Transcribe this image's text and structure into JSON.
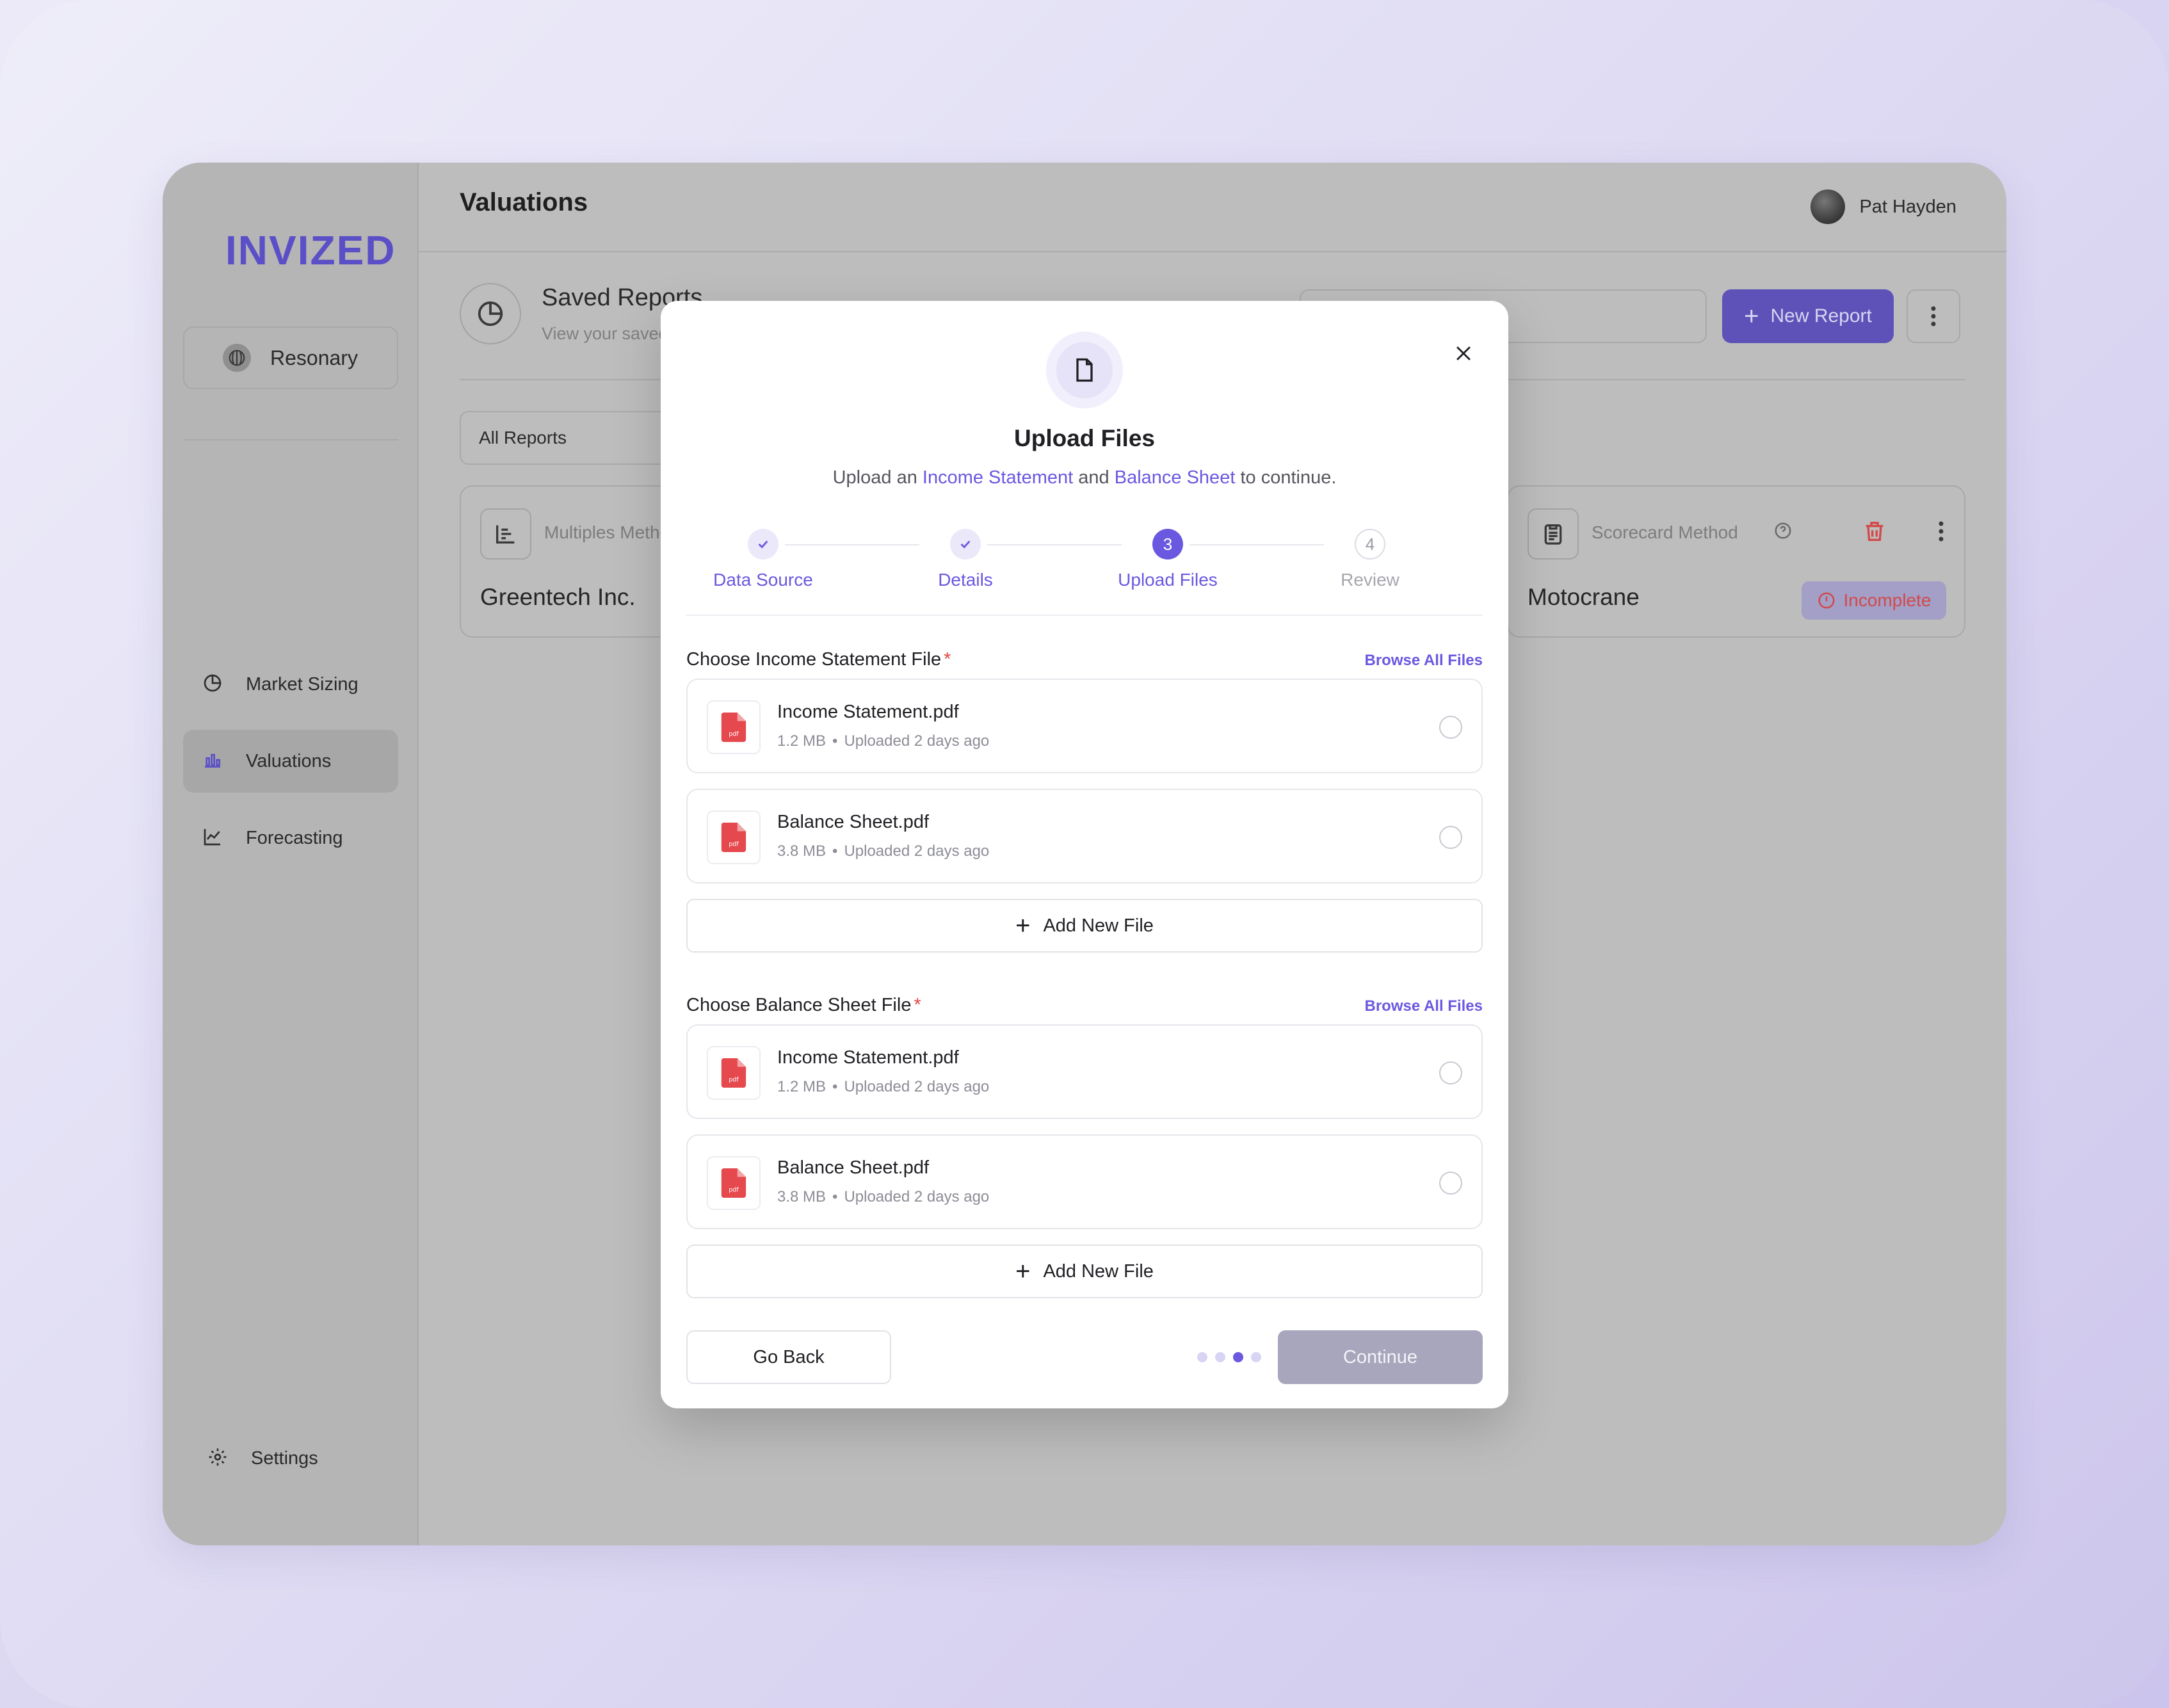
{
  "app": {
    "logo": "INVIZED",
    "workspace": "Resonary",
    "nav": [
      {
        "label": "Market Sizing",
        "icon": "pie-chart-icon"
      },
      {
        "label": "Valuations",
        "icon": "bar-chart-icon",
        "active": true
      },
      {
        "label": "Forecasting",
        "icon": "line-chart-icon"
      }
    ],
    "settings_label": "Settings"
  },
  "topbar": {
    "title": "Valuations",
    "user_name": "Pat Hayden"
  },
  "header": {
    "title": "Saved Reports",
    "subtitle": "View your saved reports",
    "new_report_label": "New Report",
    "plus": "+"
  },
  "filter": {
    "label": "All Reports"
  },
  "cards": [
    {
      "method": "Multiples Method",
      "company": "Greentech Inc."
    },
    {
      "method": "Scorecard Method",
      "company": "Motocrane",
      "status": "Incomplete"
    }
  ],
  "modal": {
    "title": "Upload Files",
    "subtitle_pre": "Upload an ",
    "subtitle_link1": "Income Statement",
    "subtitle_mid": " and ",
    "subtitle_link2": "Balance Sheet",
    "subtitle_post": " to continue.",
    "steps": [
      {
        "label": "Data Source",
        "state": "done"
      },
      {
        "label": "Details",
        "state": "done"
      },
      {
        "number": "3",
        "label": "Upload Files",
        "state": "current"
      },
      {
        "number": "4",
        "label": "Review",
        "state": "todo"
      }
    ],
    "sections": [
      {
        "label": "Choose Income Statement File",
        "required_mark": "*",
        "browse_label": "Browse All Files",
        "files": [
          {
            "name": "Income Statement.pdf",
            "size": "1.2 MB",
            "uploaded": "Uploaded 2 days ago"
          },
          {
            "name": "Balance Sheet.pdf",
            "size": "3.8 MB",
            "uploaded": "Uploaded 2 days ago"
          }
        ],
        "add_label": "Add New File"
      },
      {
        "label": "Choose Balance Sheet File",
        "required_mark": "*",
        "browse_label": "Browse All Files",
        "files": [
          {
            "name": "Income Statement.pdf",
            "size": "1.2 MB",
            "uploaded": "Uploaded 2 days ago"
          },
          {
            "name": "Balance Sheet.pdf",
            "size": "3.8 MB",
            "uploaded": "Uploaded 2 days ago"
          }
        ],
        "add_label": "Add New File"
      }
    ],
    "meta_separator": "•",
    "go_back_label": "Go Back",
    "continue_label": "Continue",
    "pager": {
      "total": 4,
      "current": 3
    },
    "file_type_label": "pdf"
  },
  "colors": {
    "accent": "#6a58e0",
    "danger": "#e04545"
  }
}
